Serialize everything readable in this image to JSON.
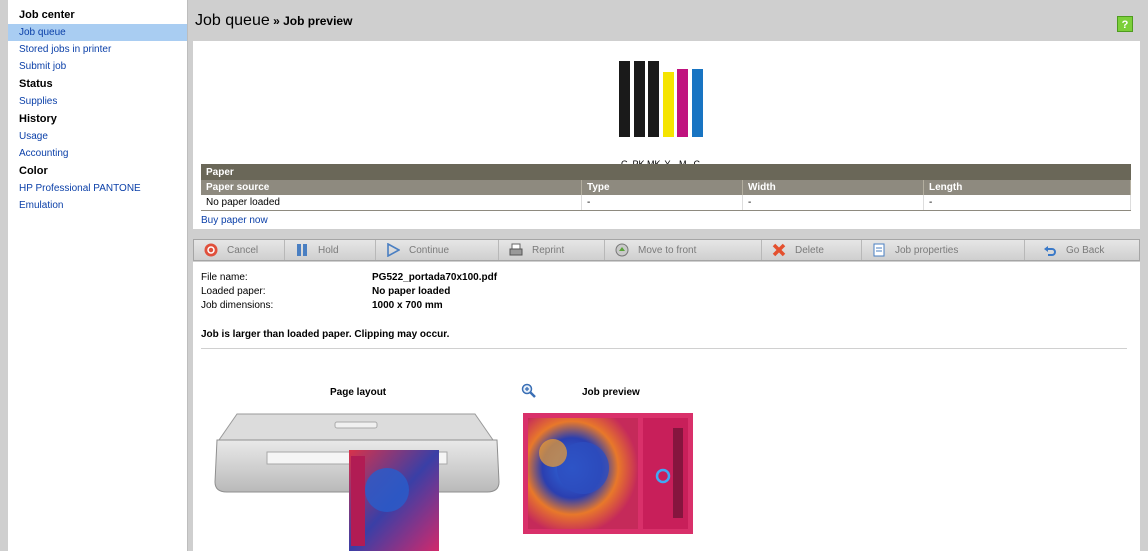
{
  "sidebar": {
    "sections": [
      {
        "heading": "Job center",
        "items": [
          "Job queue",
          "Stored jobs in printer",
          "Submit job"
        ]
      },
      {
        "heading": "Status",
        "items": [
          "Supplies"
        ]
      },
      {
        "heading": "History",
        "items": [
          "Usage",
          "Accounting"
        ]
      },
      {
        "heading": "Color",
        "items": [
          "HP Professional PANTONE Emulation"
        ]
      }
    ],
    "active_item": "Job queue"
  },
  "header": {
    "title": "Job queue",
    "separator": " » ",
    "subtitle": "Job preview",
    "help_label": "?"
  },
  "inks": [
    {
      "label": "G",
      "color": "#1a1a1a",
      "level": 1.0
    },
    {
      "label": "PK",
      "color": "#1a1a1a",
      "level": 1.0
    },
    {
      "label": "MK",
      "color": "#1a1a1a",
      "level": 1.0
    },
    {
      "label": "Y",
      "color": "#f5e400",
      "level": 0.85
    },
    {
      "label": "M",
      "color": "#c0127e",
      "level": 0.9
    },
    {
      "label": "C",
      "color": "#1874c2",
      "level": 0.9
    }
  ],
  "paper": {
    "title": "Paper",
    "columns": [
      "Paper source",
      "Type",
      "Width",
      "Length"
    ],
    "row": [
      "No paper loaded",
      "-",
      "-",
      "-"
    ],
    "buy_link": "Buy paper now"
  },
  "toolbar": [
    {
      "label": "Cancel",
      "icon": "cancel-icon"
    },
    {
      "label": "Hold",
      "icon": "hold-icon"
    },
    {
      "label": "Continue",
      "icon": "continue-icon"
    },
    {
      "label": "Reprint",
      "icon": "reprint-icon"
    },
    {
      "label": "Move to front",
      "icon": "move-to-front-icon"
    },
    {
      "label": "Delete",
      "icon": "delete-icon"
    },
    {
      "label": "Job properties",
      "icon": "job-properties-icon"
    },
    {
      "label": "Go Back",
      "icon": "go-back-icon"
    }
  ],
  "job": {
    "file_name_label": "File name:",
    "file_name": "PG522_portada70x100.pdf",
    "loaded_paper_label": "Loaded paper:",
    "loaded_paper": "No paper loaded",
    "dimensions_label": "Job dimensions:",
    "dimensions": "1000 x 700 mm",
    "warning": "Job is larger than loaded paper. Clipping may occur."
  },
  "preview": {
    "page_layout_label": "Page layout",
    "job_preview_label": "Job preview"
  }
}
